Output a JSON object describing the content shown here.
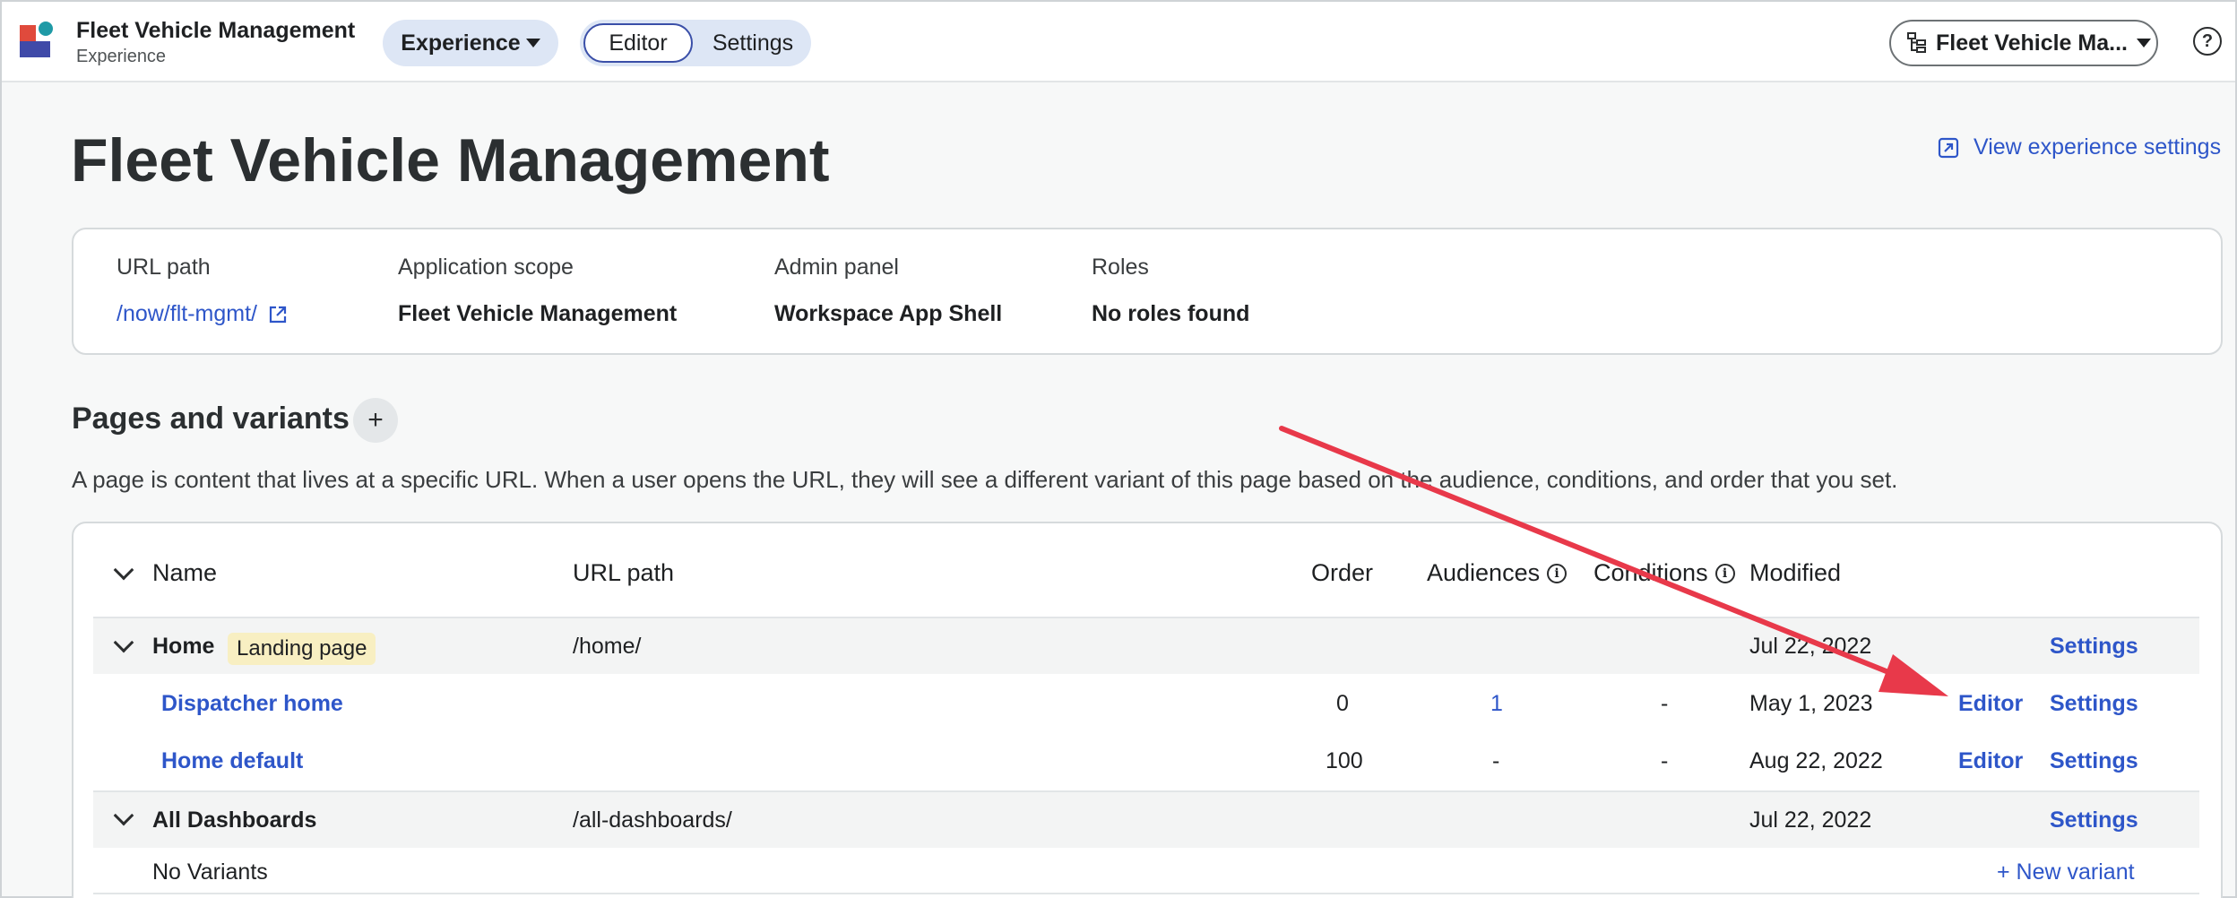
{
  "app": {
    "title": "Fleet Vehicle Management",
    "subtitle": "Experience",
    "experience_dropdown": "Experience",
    "tabs": [
      "Editor",
      "Settings"
    ],
    "active_tab": "Editor",
    "scope_dropdown": "Fleet Vehicle Ma...",
    "help_label": "?"
  },
  "page": {
    "title": "Fleet Vehicle Management",
    "view_settings_link": "View experience settings"
  },
  "info": {
    "url_path_label": "URL path",
    "url_path_value": "/now/flt-mgmt/",
    "app_scope_label": "Application scope",
    "app_scope_value": "Fleet Vehicle Management",
    "admin_panel_label": "Admin panel",
    "admin_panel_value": "Workspace App Shell",
    "roles_label": "Roles",
    "roles_value": "No roles found"
  },
  "pages_section": {
    "title": "Pages and variants",
    "add_label": "+",
    "description": "A page is content that lives at a specific URL. When a user opens the URL, they will see a different variant of this page based on the audience, conditions, and order that you set."
  },
  "table": {
    "headers": {
      "name": "Name",
      "url_path": "URL path",
      "order": "Order",
      "audiences": "Audiences",
      "conditions": "Conditions",
      "modified": "Modified"
    },
    "home": {
      "name": "Home",
      "badge": "Landing page",
      "url": "/home/",
      "modified": "Jul 22, 2022",
      "settings": "Settings"
    },
    "variants": [
      {
        "name": "Dispatcher home",
        "order": "0",
        "audiences": "1",
        "conditions": "-",
        "modified": "May 1, 2023",
        "editor": "Editor",
        "settings": "Settings"
      },
      {
        "name": "Home default",
        "order": "100",
        "audiences": "-",
        "conditions": "-",
        "modified": "Aug 22, 2022",
        "editor": "Editor",
        "settings": "Settings"
      }
    ],
    "dashboards": {
      "name": "All Dashboards",
      "url": "/all-dashboards/",
      "modified": "Jul 22, 2022",
      "settings": "Settings",
      "no_variants": "No Variants",
      "new_variant": "+ New variant"
    }
  },
  "colors": {
    "link": "#2e56c9",
    "annotation_arrow": "#e8394a",
    "badge_bg": "#f8efc2",
    "pill_bg": "#dde6f5"
  }
}
